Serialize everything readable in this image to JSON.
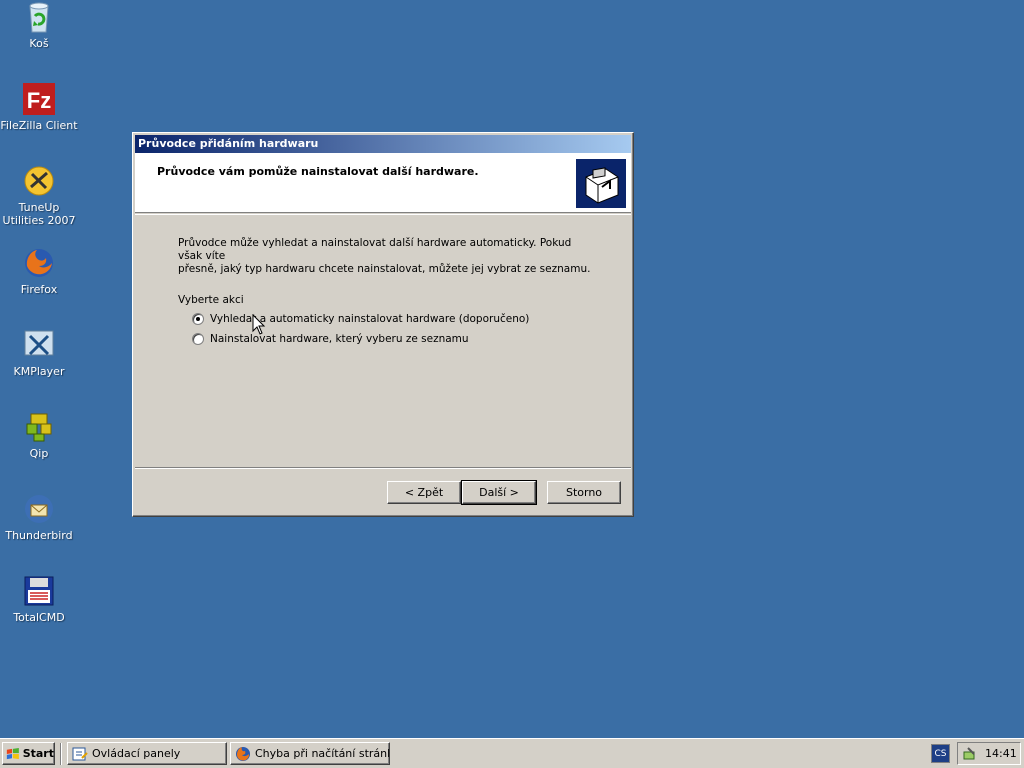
{
  "desktop": {
    "icons": [
      {
        "label": "Koš",
        "icon": "recycle-bin-icon"
      },
      {
        "label": "FileZilla Client",
        "icon": "filezilla-icon"
      },
      {
        "label": "TuneUp Utilities 2007",
        "icon": "tuneup-icon"
      },
      {
        "label": "Firefox",
        "icon": "firefox-icon"
      },
      {
        "label": "KMPlayer",
        "icon": "kmplayer-icon"
      },
      {
        "label": "Qip",
        "icon": "qip-icon"
      },
      {
        "label": "Thunderbird",
        "icon": "thunderbird-icon"
      },
      {
        "label": "TotalCMD",
        "icon": "totalcmd-icon"
      }
    ],
    "background_color": "#3a6ea5"
  },
  "dialog": {
    "title": "Průvodce přidáním hardwaru",
    "header_title": "Průvodce vám pomůže nainstalovat další hardware.",
    "header_icon": "hardware-wizard-icon",
    "intro_line1": "Průvodce může vyhledat a nainstalovat další hardware automaticky. Pokud však víte",
    "intro_line2": "přesně, jaký typ hardwaru chcete nainstalovat, můžete jej vybrat ze seznamu.",
    "group_label": "Vyberte akci",
    "options": [
      {
        "label": "Vyhledat a automaticky nainstalovat hardware (doporučeno)",
        "selected": true
      },
      {
        "label": "Nainstalovat hardware, který vyberu ze seznamu",
        "selected": false
      }
    ],
    "buttons": {
      "back": "< Zpět",
      "next": "Další >",
      "cancel": "Storno"
    }
  },
  "taskbar": {
    "start_label": "Start",
    "tasks": [
      {
        "label": "Ovládací panely",
        "icon": "control-panel-icon"
      },
      {
        "label": "Chyba při načítání stránk...",
        "icon": "firefox-icon"
      }
    ],
    "language": "CS",
    "clock": "14:41"
  }
}
